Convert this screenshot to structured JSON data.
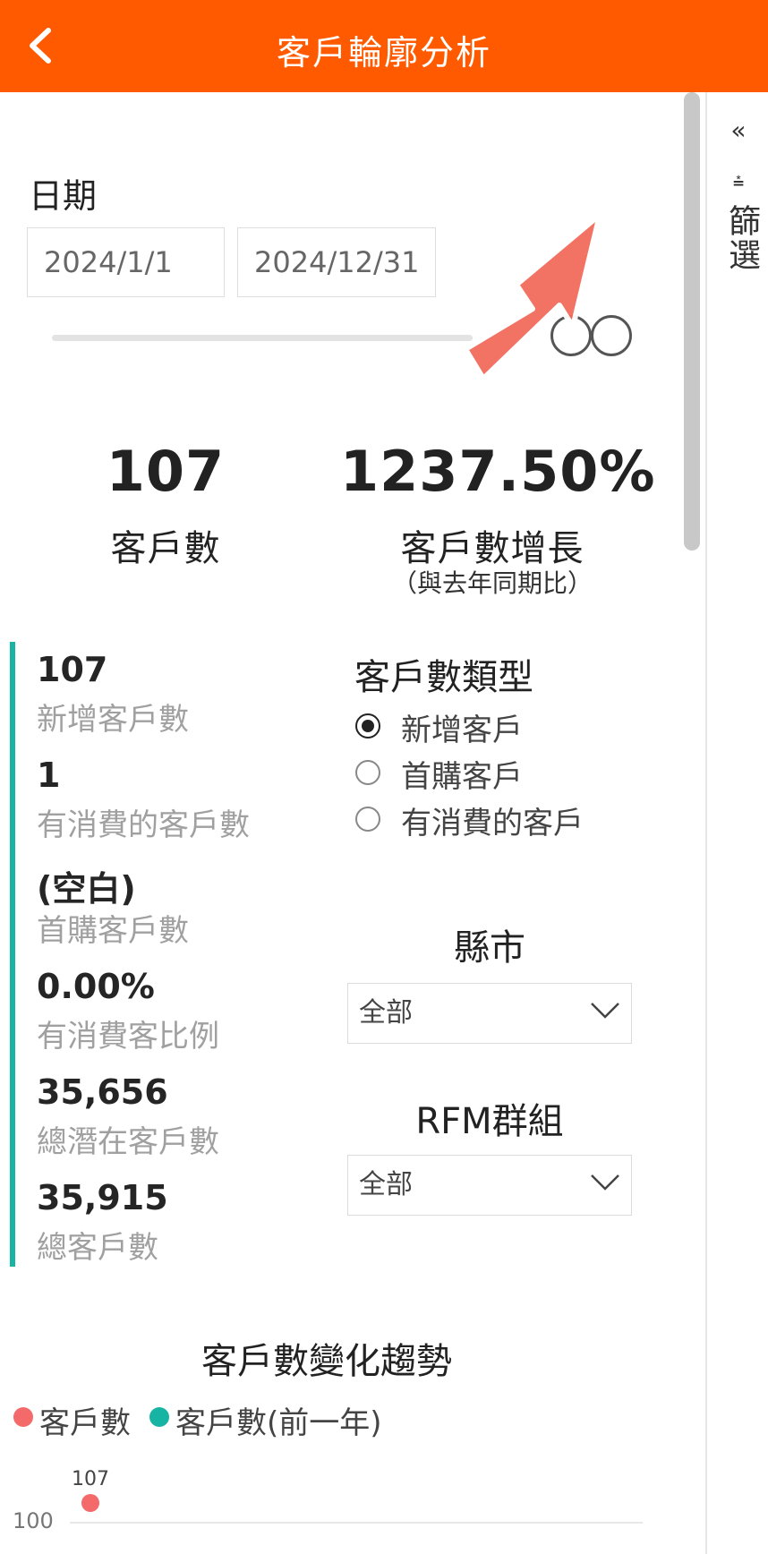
{
  "header": {
    "title": "客戶輪廓分析"
  },
  "side_panel": {
    "collapse_glyph": "«",
    "filter_glyph": "⩮",
    "filter_label": "篩選"
  },
  "date": {
    "label": "日期",
    "start": "2024/1/1",
    "end": "2024/12/31"
  },
  "kpis": [
    {
      "value": "107",
      "label": "客戶數"
    },
    {
      "value": "1237.50%",
      "label": "客戶數增長",
      "sub": "（與去年同期比）"
    }
  ],
  "stats": [
    {
      "value": "107",
      "label": "新增客戶數"
    },
    {
      "value": "1",
      "label": "有消費的客戶數"
    },
    {
      "value": "(空白)",
      "label": "首購客戶數"
    },
    {
      "value": "0.00%",
      "label": "有消費客比例"
    },
    {
      "value": "35,656",
      "label": "總潛在客戶數"
    },
    {
      "value": "35,915",
      "label": "總客戶數"
    }
  ],
  "customer_type": {
    "title": "客戶數類型",
    "options": [
      "新增客戶",
      "首購客戶",
      "有消費的客戶"
    ],
    "selected": "新增客戶"
  },
  "county_filter": {
    "title": "縣市",
    "value": "全部"
  },
  "rfm_filter": {
    "title": "RFM群組",
    "value": "全部"
  },
  "colors": {
    "header": "#ff5a00",
    "accent": "#17b3a3",
    "series_current": "#f46a6a",
    "series_previous": "#17b3a3"
  },
  "chart_data": {
    "type": "line",
    "title": "客戶數變化趨勢",
    "series": [
      {
        "name": "客戶數",
        "values": [
          107
        ]
      },
      {
        "name": "客戶數(前一年)",
        "values": []
      }
    ],
    "y_ticks": [
      "100"
    ],
    "data_labels": [
      "107"
    ],
    "legend_position": "top-left"
  }
}
